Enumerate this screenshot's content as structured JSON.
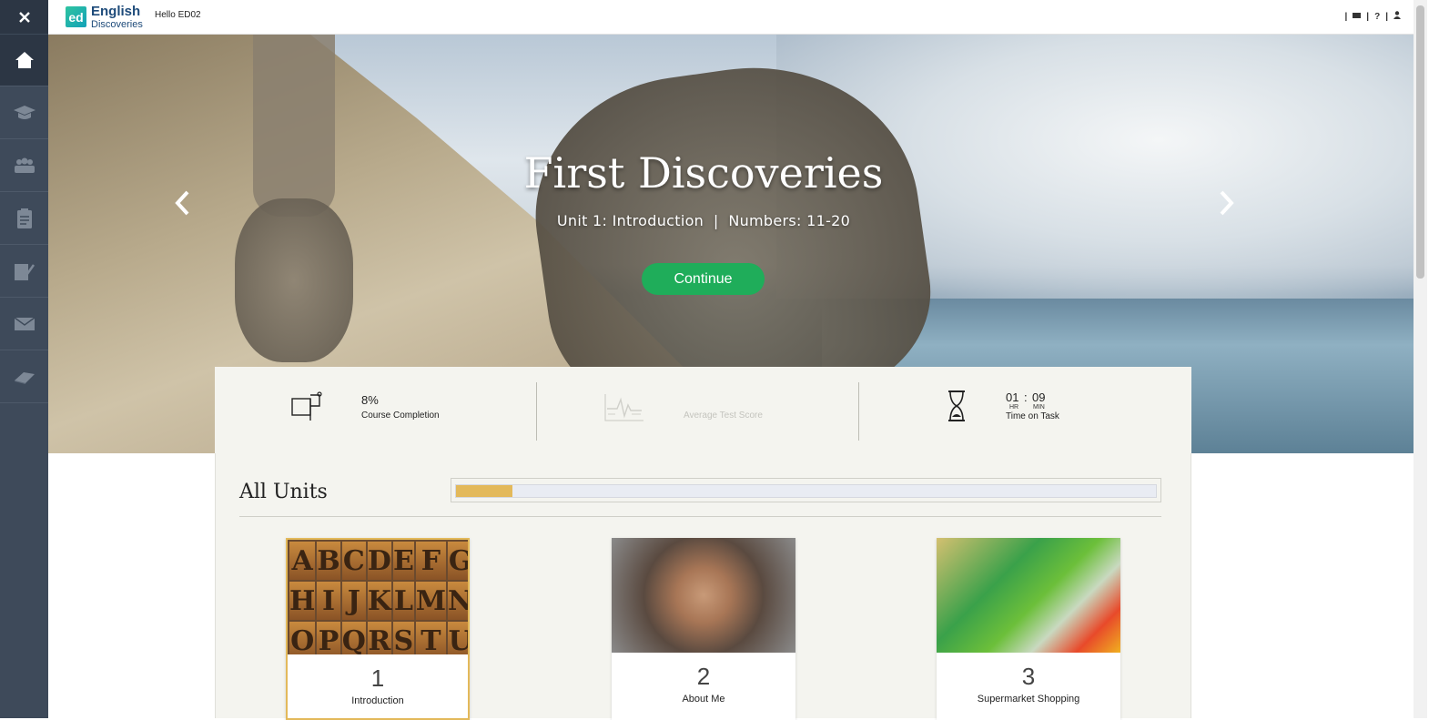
{
  "sidebar": {
    "close_icon": "close-icon",
    "items": [
      {
        "name": "home",
        "icon": "home-icon",
        "active": true
      },
      {
        "name": "courses",
        "icon": "graduation-cap-icon",
        "active": false
      },
      {
        "name": "community",
        "icon": "group-icon",
        "active": false
      },
      {
        "name": "assignments",
        "icon": "clipboard-icon",
        "active": false
      },
      {
        "name": "tests",
        "icon": "checklist-icon",
        "active": false
      },
      {
        "name": "messages",
        "icon": "envelope-icon",
        "active": false
      },
      {
        "name": "library",
        "icon": "book-icon",
        "active": false
      }
    ]
  },
  "header": {
    "logo_mark": "ed",
    "logo_line1": "English",
    "logo_line2": "Discoveries",
    "greeting": "Hello ED02",
    "icons": [
      "book-icon",
      "help-icon",
      "user-icon"
    ],
    "help_label": "?"
  },
  "hero": {
    "title": "First Discoveries",
    "subtitle": "Unit 1: Introduction  |  Numbers: 11-20",
    "continue_label": "Continue"
  },
  "stats": {
    "completion": {
      "value": "8%",
      "label": "Course Completion"
    },
    "avg_score": {
      "label": "Average Test Score"
    },
    "time": {
      "hours": "01",
      "separator": ":",
      "minutes": "09",
      "hr_label": "HR",
      "min_label": "MIN",
      "label": "Time on Task"
    }
  },
  "units": {
    "heading": "All Units",
    "progress_fraction": 0.08,
    "colors": {
      "progress_fill": "#e3b95a",
      "continue_button": "#1fad5a"
    },
    "cards": [
      {
        "number": "1",
        "name": "Introduction",
        "current": true,
        "letters": [
          "A",
          "B",
          "C",
          "D",
          "E",
          "F",
          "G",
          "H",
          "I",
          "J",
          "K",
          "L",
          "M",
          "N",
          "O",
          "P",
          "Q",
          "R",
          "S",
          "T",
          "U"
        ]
      },
      {
        "number": "2",
        "name": "About Me",
        "current": false
      },
      {
        "number": "3",
        "name": "Supermarket Shopping",
        "current": false
      }
    ]
  }
}
